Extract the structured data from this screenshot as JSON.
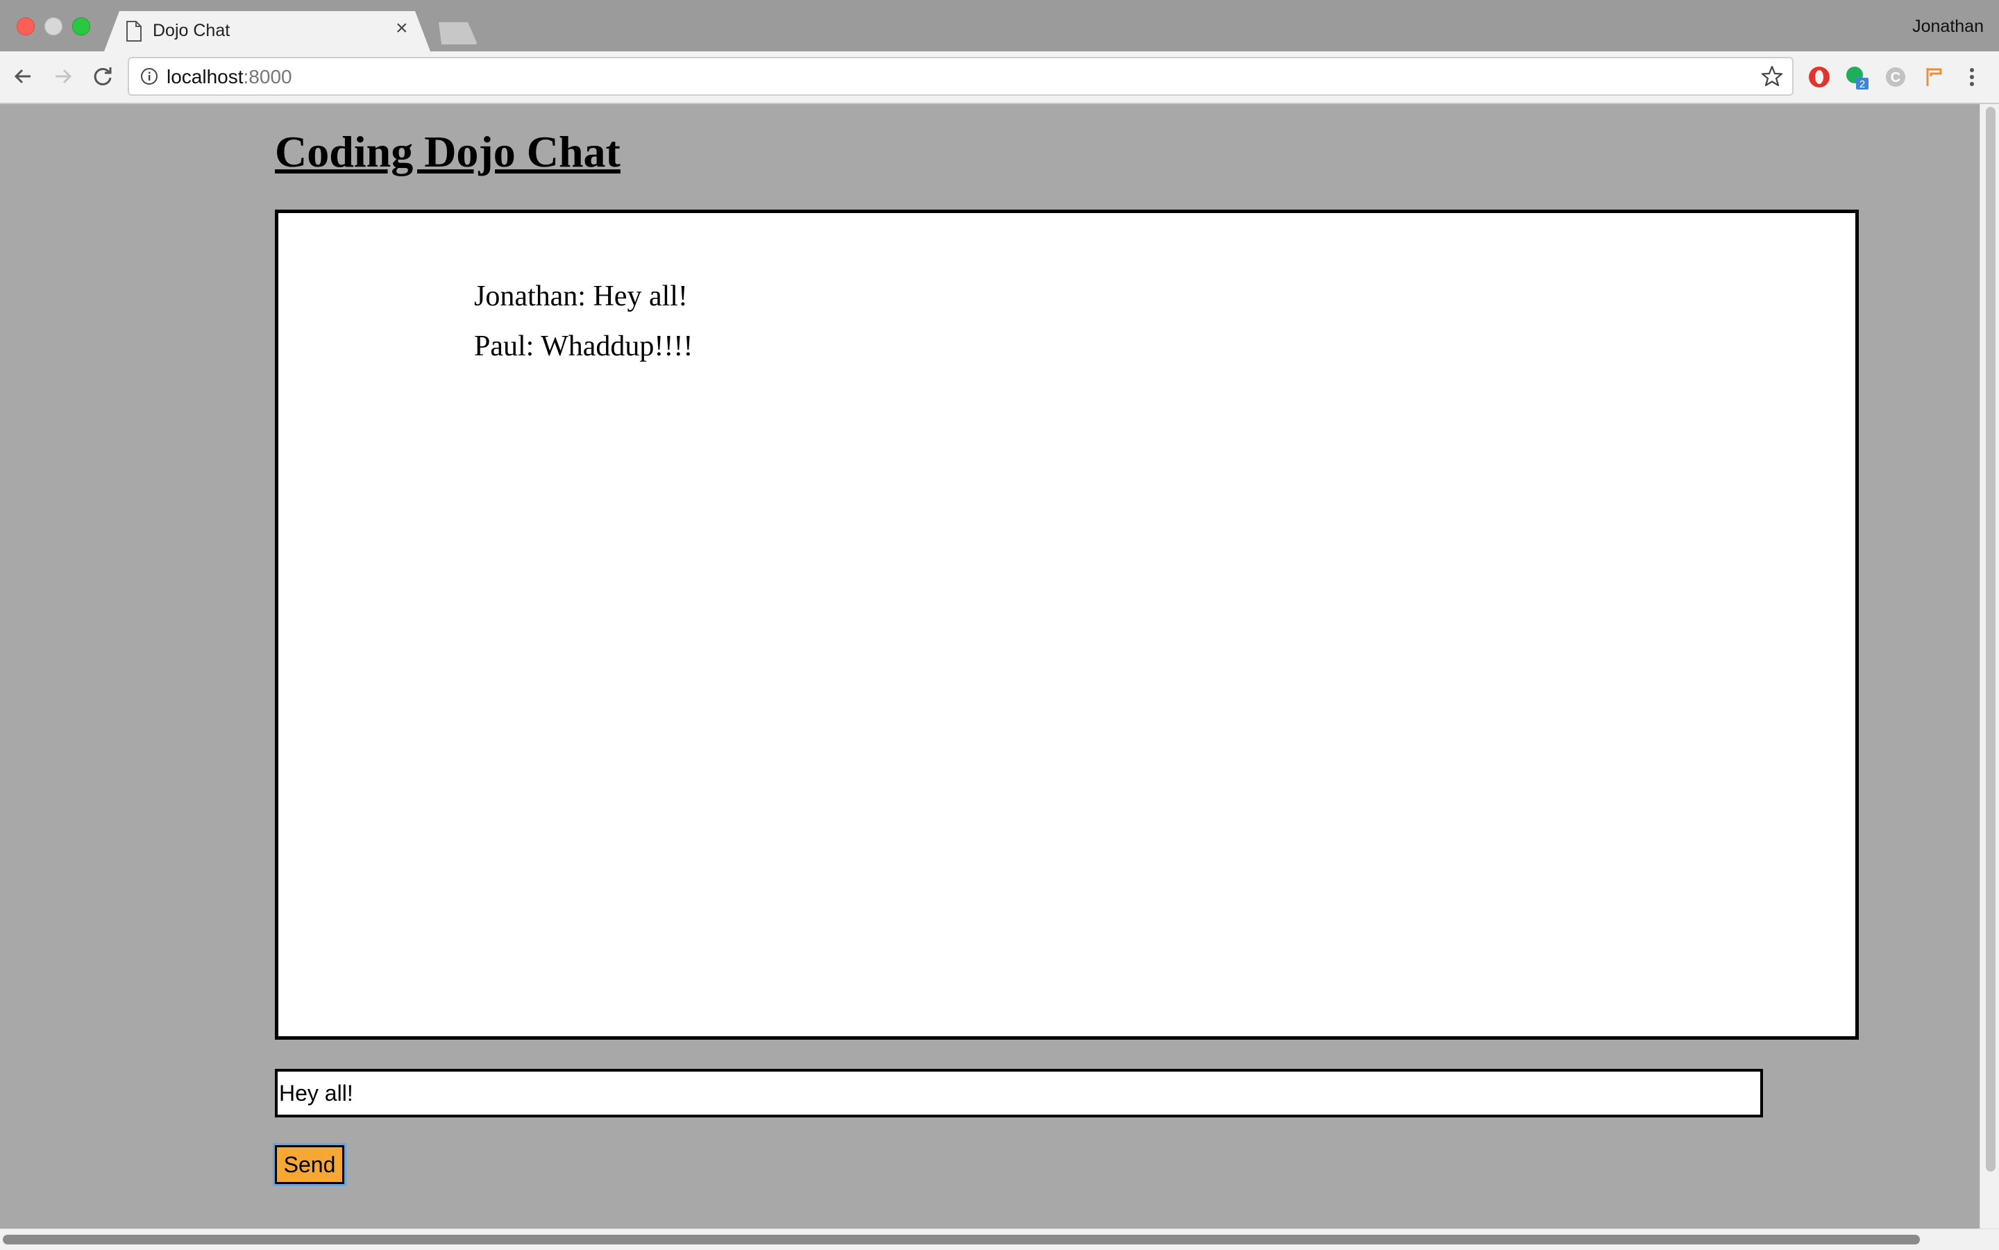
{
  "browser": {
    "tab_title": "Dojo Chat",
    "profile_name": "Jonathan",
    "url_host": "localhost",
    "url_port": ":8000",
    "extension_badge": "2",
    "extension_letter": "C"
  },
  "page": {
    "title": "Coding Dojo Chat",
    "messages": [
      "Jonathan: Hey all!",
      "Paul: Whaddup!!!!"
    ],
    "input_value": "Hey all!",
    "send_label": "Send"
  },
  "colors": {
    "page_background": "#a8a8a8",
    "send_button": "#f7a734"
  }
}
